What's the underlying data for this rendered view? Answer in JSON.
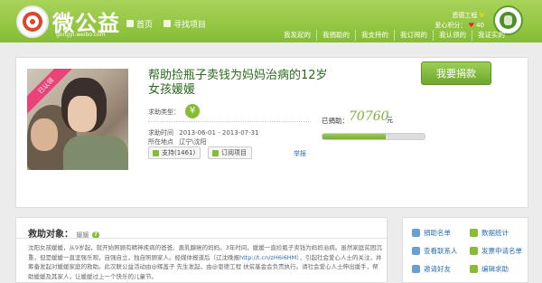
{
  "header": {
    "logo_text": "微公益",
    "logo_sub": "gongyi.weibo.com",
    "nav": [
      {
        "label": "首页"
      },
      {
        "label": "寻找项目"
      }
    ],
    "user": {
      "name": "恩德工程",
      "vbadge": "V",
      "love_label": "爱心积分：",
      "love_score": "40"
    },
    "tabs": [
      "我发起的",
      "我捐助的",
      "我支持的",
      "我订阅的",
      "我认领的",
      "我证实的"
    ]
  },
  "project": {
    "ribbon": "已认领",
    "title": "帮助捡瓶子卖钱为妈妈治病的12岁女孩媛媛",
    "type_label": "求助类型：",
    "time_label": "求助时间",
    "time_value": "2013-06-01 - 2013-07-31",
    "location_label": "所在地点",
    "location_value": "辽宁\\沈阳",
    "support_label": "支持(1461)",
    "subscribe_label": "订阅项目",
    "report_label": "举报",
    "raised_label": "已捐助：",
    "raised_amount": "70760",
    "raised_unit": "元",
    "progress": 0.62,
    "donate_button": "我要捐款"
  },
  "description": {
    "title": "救助对象：",
    "tag": "媛媛",
    "text_1": "沈阳女孩媛媛，从9岁起，就开始照顾有精神疾病的爸爸、患乳腺癌的妈妈。3年时间，媛媛一直捡瓶子卖钱为妈妈治病。虽然家庭贫困沉重，但是媛媛一直坚强乐观，自强自立，独自照顾家人。经媒体报道后（辽沈晚报",
    "link": "http://t.cn/zH6i6HM",
    "text_2": "），引起社会爱心人士的关注，并筹备发起对媛媛家庭的救助。此次联公益活动由@辉盖子 先生发起，由@恩德工程 扶贫基金会负责执行。请社会爱心人士伸出援手，帮助媛媛及其家人，让媛媛过上一个快乐的儿童节。"
  },
  "side": {
    "actions": [
      "捐助名单",
      "数据统计",
      "查看联系人",
      "发票申请名单",
      "邀请好友",
      "编辑求助"
    ]
  }
}
